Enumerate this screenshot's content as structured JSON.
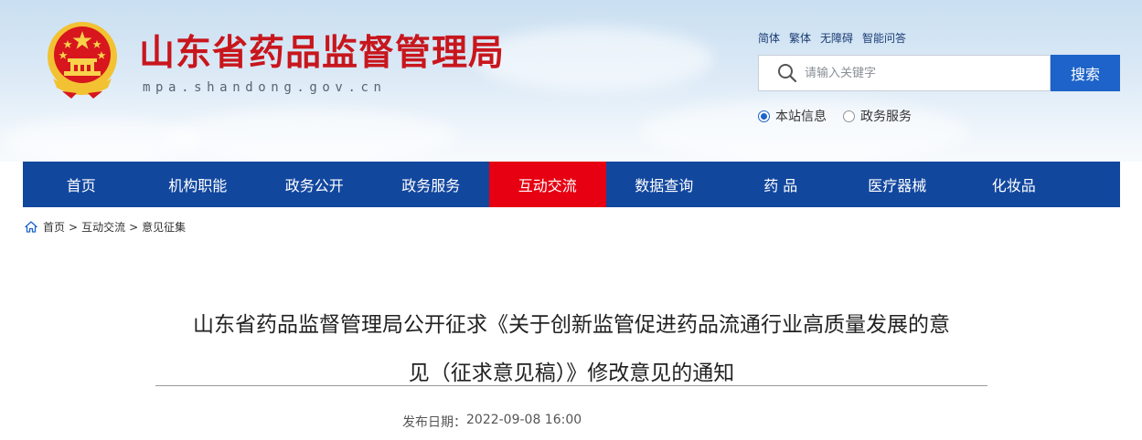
{
  "header": {
    "site_title": "山东省药品监督管理局",
    "site_domain": "mpa.shandong.gov.cn",
    "top_links": [
      "简体",
      "繁体",
      "无障碍",
      "智能问答"
    ],
    "search": {
      "placeholder": "请输入关键字",
      "button_label": "搜索"
    },
    "scope_options": [
      {
        "label": "本站信息",
        "checked": true
      },
      {
        "label": "政务服务",
        "checked": false
      }
    ]
  },
  "nav": {
    "items": [
      {
        "label": "首页",
        "active": false
      },
      {
        "label": "机构职能",
        "active": false
      },
      {
        "label": "政务公开",
        "active": false
      },
      {
        "label": "政务服务",
        "active": false
      },
      {
        "label": "互动交流",
        "active": true
      },
      {
        "label": "数据查询",
        "active": false
      },
      {
        "label": "药 品",
        "active": false
      },
      {
        "label": "医疗器械",
        "active": false
      },
      {
        "label": "化妆品",
        "active": false
      }
    ]
  },
  "breadcrumb": {
    "items": [
      "首页",
      "互动交流",
      "意见征集"
    ],
    "separator": ">"
  },
  "article": {
    "title_line1": "山东省药品监督管理局公开征求《关于创新监管促进药品流通行业高质量发展的意",
    "title_line2": "见（征求意见稿）》修改意见的通知",
    "date_label": "发布日期：",
    "date_value": "2022-09-08 16:00"
  },
  "colors": {
    "brand_red": "#c8161d",
    "nav_blue": "#12479e",
    "nav_active_red": "#e60012",
    "search_blue": "#1d63c9",
    "emblem_gold": "#f2c232"
  },
  "icons": [
    "national-emblem-icon",
    "search-icon",
    "home-icon"
  ]
}
